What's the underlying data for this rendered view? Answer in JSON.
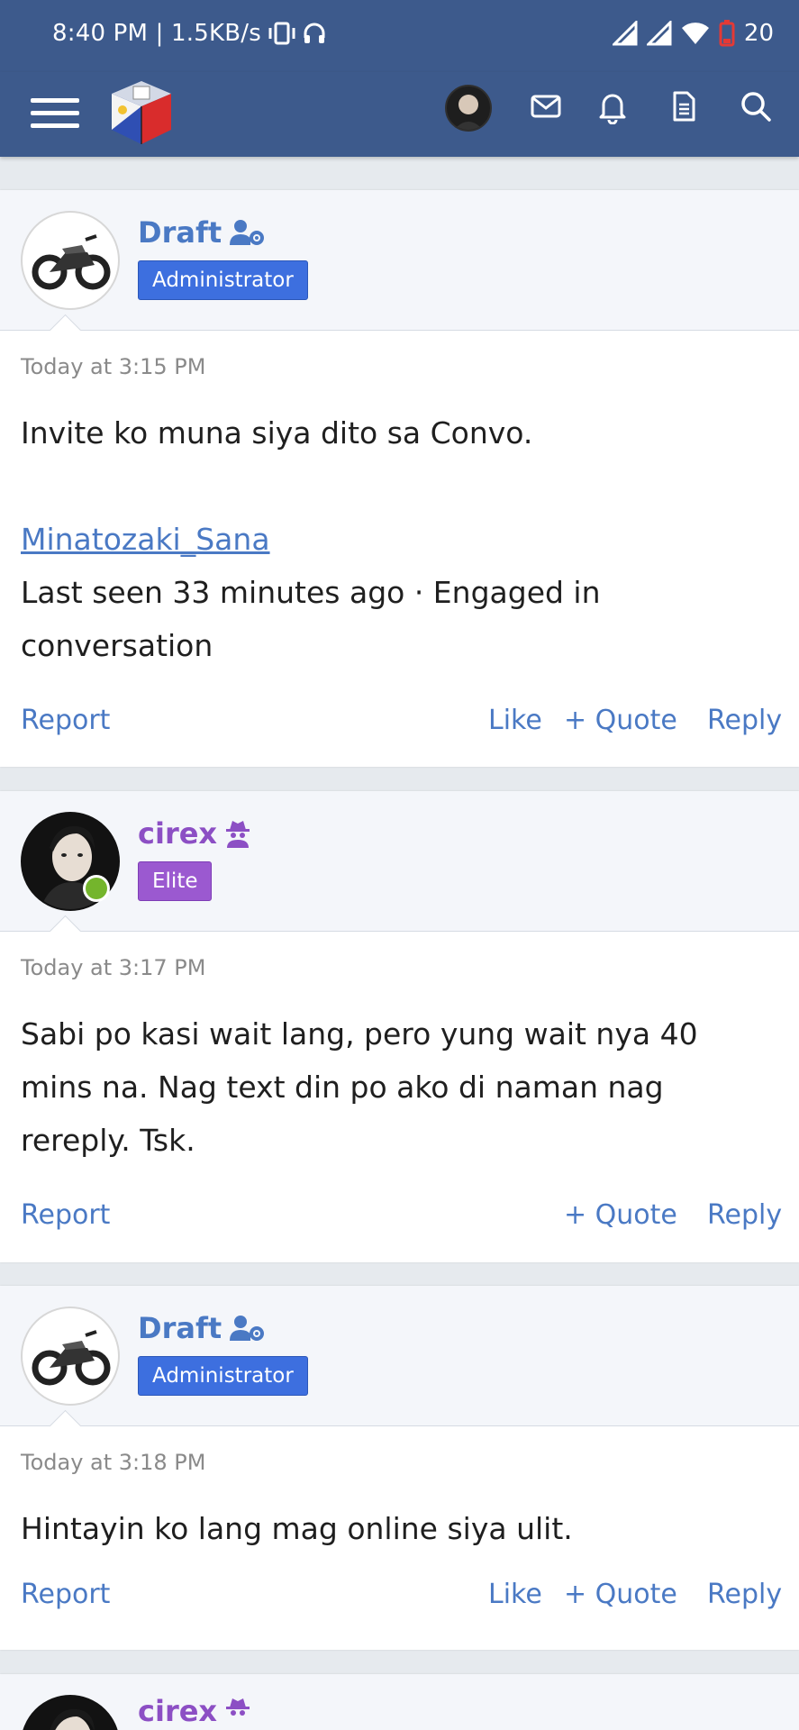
{
  "status_bar": {
    "time_speed": "8:40 PM | 1.5KB/s",
    "battery": "20"
  },
  "nav": {
    "icons": [
      "menu-icon",
      "site-logo",
      "user-avatar",
      "mail-icon",
      "bell-icon",
      "document-icon",
      "search-icon"
    ]
  },
  "posts": [
    {
      "username": "Draft",
      "role_icon": "admin-gear-icon",
      "badge": "Administrator",
      "date": "Today at 3:15 PM",
      "text1": "Invite ko muna siya dito sa Convo.",
      "link": "Minatozaki_Sana",
      "text2": "Last seen 33 minutes ago · Engaged in conversation",
      "actions": {
        "report": "Report",
        "like": "Like",
        "quote": "+ Quote",
        "reply": "Reply"
      }
    },
    {
      "username": "cirex",
      "role_icon": "elite-spy-icon",
      "badge": "Elite",
      "date": "Today at 3:17 PM",
      "text": "Sabi po kasi wait lang, pero yung wait nya 40 mins na. Nag text din po ako di naman nag rereply. Tsk.",
      "actions": {
        "report": "Report",
        "quote": "+ Quote",
        "reply": "Reply"
      }
    },
    {
      "username": "Draft",
      "role_icon": "admin-gear-icon",
      "badge": "Administrator",
      "date": "Today at 3:18 PM",
      "text": "Hintayin ko lang mag online siya ulit.",
      "actions": {
        "report": "Report",
        "like": "Like",
        "quote": "+ Quote",
        "reply": "Reply"
      }
    },
    {
      "username": "cirex",
      "role_icon": "elite-spy-icon"
    }
  ],
  "colors": {
    "header_bg": "#3d5a8c",
    "link_blue": "#4a79c4",
    "admin_badge": "#3d6fdf",
    "elite_purple": "#9b59d0",
    "online_green": "#74b52c"
  }
}
